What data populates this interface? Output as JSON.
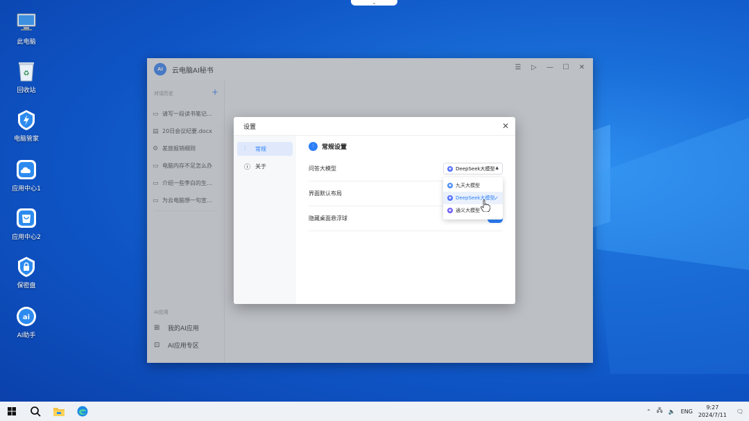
{
  "desktop": {
    "icons": [
      {
        "label": "此电脑",
        "icon": "computer-icon"
      },
      {
        "label": "回收站",
        "icon": "recycle-bin-icon"
      },
      {
        "label": "电脑管家",
        "icon": "pc-manager-icon"
      },
      {
        "label": "应用中心1",
        "icon": "cloud-app-icon"
      },
      {
        "label": "应用中心2",
        "icon": "shopping-bag-icon"
      },
      {
        "label": "保密盘",
        "icon": "lock-disk-icon"
      },
      {
        "label": "AI助手",
        "icon": "ai-assistant-icon"
      }
    ],
    "top_handle": "⌄"
  },
  "app": {
    "logo_text": "AI",
    "title": "云电脑AI秘书",
    "history_title": "对话历史",
    "add": "+",
    "history": [
      {
        "icon": "chat-icon",
        "label": "请写一段读书笔记…"
      },
      {
        "icon": "doc-icon",
        "label": "20日会议纪要.docx"
      },
      {
        "icon": "gear-icon",
        "label": "差旅报销细则"
      },
      {
        "icon": "chat-icon",
        "label": "电脑内存不足怎么办"
      },
      {
        "icon": "chat-icon",
        "label": "介绍一些李白的生…"
      },
      {
        "icon": "chat-icon",
        "label": "为云电脑想一句宣…"
      }
    ],
    "ai_title": "AI应用",
    "ai_items": [
      {
        "icon": "apps-icon",
        "label": "我的AI应用"
      },
      {
        "icon": "ai-store-icon",
        "label": "AI应用专区"
      }
    ]
  },
  "settings": {
    "title": "设置",
    "nav": [
      {
        "icon": "sliders-icon",
        "label": "常规"
      },
      {
        "icon": "info-icon",
        "label": "关于"
      }
    ],
    "section_title": "常规设置",
    "rows": [
      {
        "label": "问答大模型"
      },
      {
        "label": "界面默认布局"
      },
      {
        "label": "隐藏桌面悬浮球"
      }
    ],
    "model_select": {
      "value": "DeepSeek大模型"
    },
    "model_options": [
      {
        "label": "九天大模型",
        "color": "#4a8df6"
      },
      {
        "label": "DeepSeek大模型",
        "color": "#4d6bfe"
      },
      {
        "label": "通义大模型",
        "color": "#6e5cf6"
      }
    ],
    "selected_option": "DeepSeek大模型",
    "hide_ball_enabled": true
  },
  "taskbar": {
    "lang": "ENG",
    "time": "9:27",
    "date": "2024/7/11"
  }
}
